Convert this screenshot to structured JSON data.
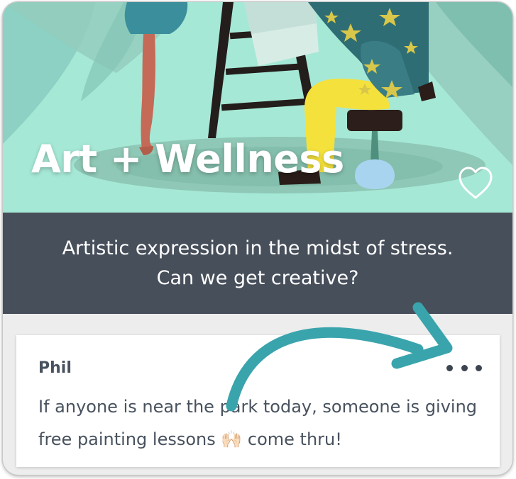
{
  "hero": {
    "title": "Art + Wellness",
    "heart_icon": "heart-outline-icon"
  },
  "subtitle": {
    "line1": "Artistic expression in the midst of stress.",
    "line2": "Can we get creative?"
  },
  "comment": {
    "author": "Phil",
    "text": "If anyone is near the park today, someone is giving free painting lessons 🙌🏻 come thru!",
    "more_icon": "more-dots-icon"
  },
  "colors": {
    "hero_bg": "#a6e8d6",
    "band_bg": "#474f5b",
    "arrow": "#3aa4ad",
    "body_text": "#48525e"
  }
}
